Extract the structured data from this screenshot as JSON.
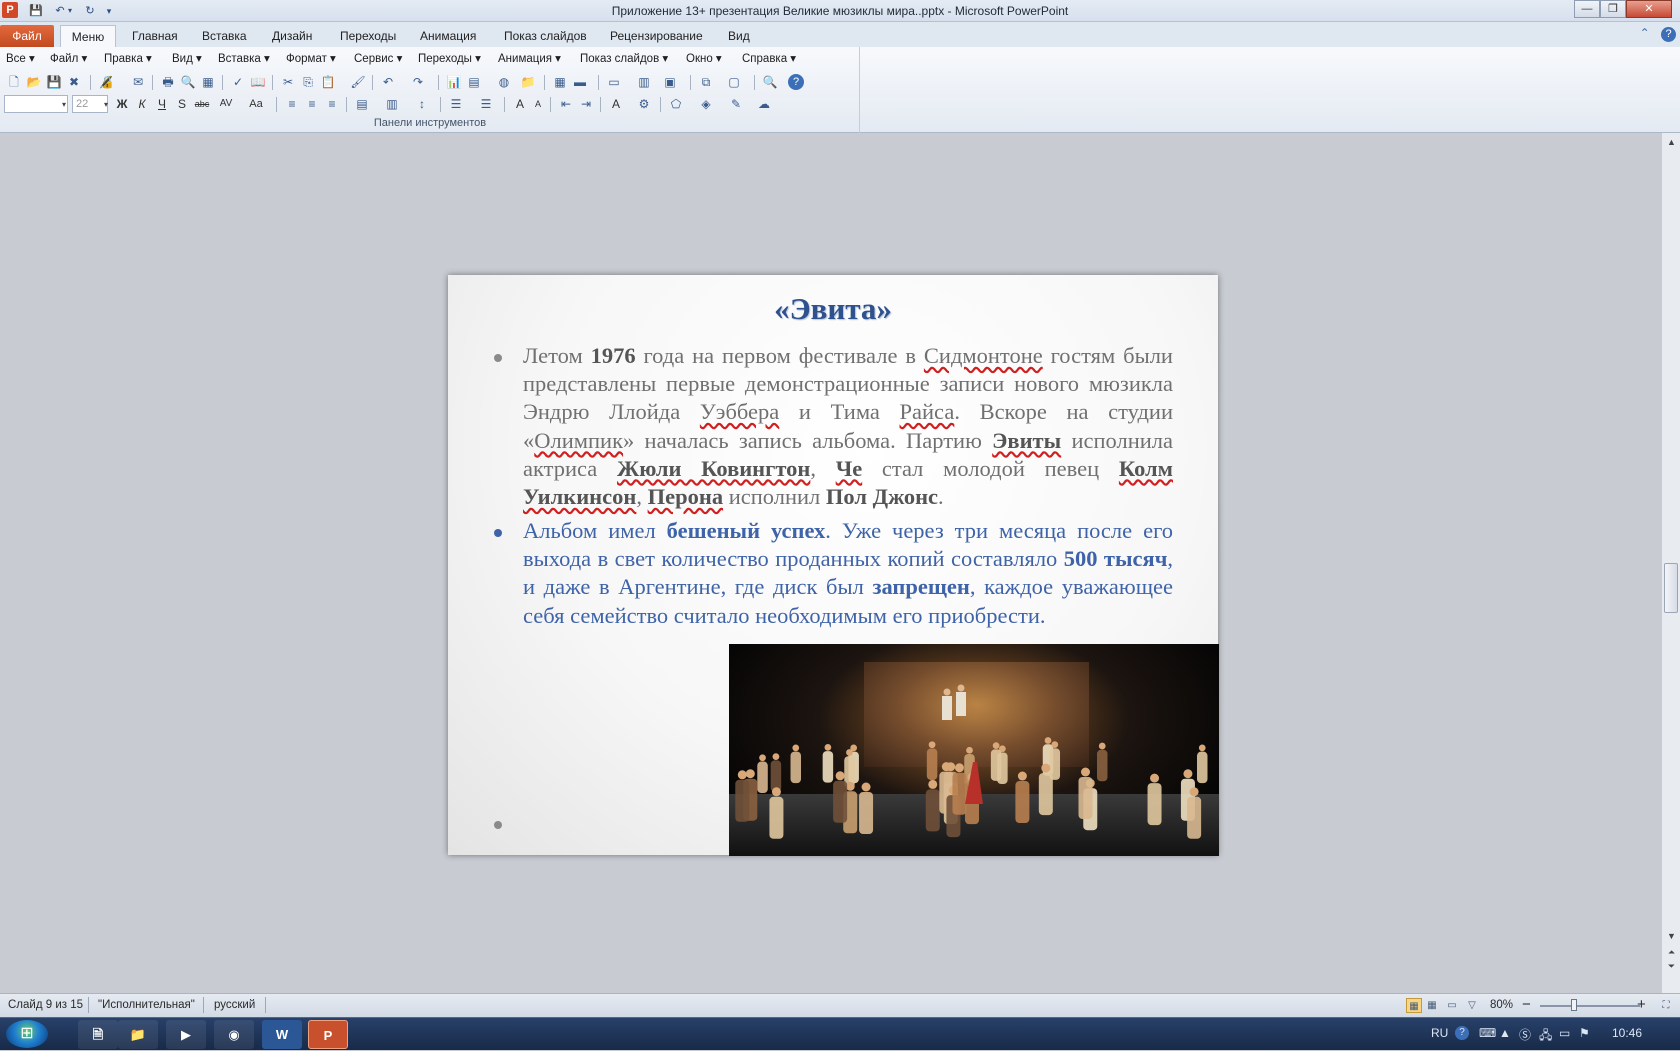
{
  "window": {
    "title": "Приложение 13+ презентация Великие мюзиклы мира..pptx - Microsoft PowerPoint",
    "app_icon_letter": "P",
    "minimize": "—",
    "restore": "❐",
    "close": "✕"
  },
  "tabs": [
    {
      "label": "Файл"
    },
    {
      "label": "Меню"
    },
    {
      "label": "Главная"
    },
    {
      "label": "Вставка"
    },
    {
      "label": "Дизайн"
    },
    {
      "label": "Переходы"
    },
    {
      "label": "Анимация"
    },
    {
      "label": "Показ слайдов"
    },
    {
      "label": "Рецензирование"
    },
    {
      "label": "Вид"
    }
  ],
  "active_tab": "Меню",
  "classic_menu": [
    {
      "label": "Все ▾"
    },
    {
      "label": "Файл ▾"
    },
    {
      "label": "Правка ▾"
    },
    {
      "label": "Вид ▾"
    },
    {
      "label": "Вставка ▾"
    },
    {
      "label": "Формат ▾"
    },
    {
      "label": "Сервис ▾"
    },
    {
      "label": "Переходы ▾"
    },
    {
      "label": "Анимация ▾"
    },
    {
      "label": "Показ слайдов ▾"
    },
    {
      "label": "Окно ▾"
    },
    {
      "label": "Справка ▾"
    }
  ],
  "toolbar": {
    "font_size_placeholder": "22",
    "group_label": "Панели инструментов",
    "row2_text": [
      "Ж",
      "К",
      "Ч",
      "S",
      "abc",
      "AV",
      "Aa"
    ]
  },
  "slide": {
    "title": "«Эвита»",
    "p1": {
      "t1": "Летом ",
      "b1": "1976",
      "t2": " года на первом фестивале в ",
      "u1": "Сидмонтоне",
      "t3": " гостям были представлены первые демонстрационные записи нового мюзикла Эндрю Ллойда ",
      "u2": "Уэббера",
      "t4": " и Тима ",
      "u3": "Райса",
      "t5": ". Вскоре на студии «",
      "u4": "Олимпик",
      "t6": "» началась запись альбома. Партию ",
      "b2": "Эвиты",
      "t7": " исполнила актриса ",
      "b3": "Жюли Ковингтон",
      "t8": ", ",
      "b4": "Че",
      "t9": " стал молодой певец ",
      "b5": "Колм Уилкинсон",
      "t10": ", ",
      "b6": "Перона",
      "t11": " исполнил ",
      "b7": "Пол Джонс",
      "t12": "."
    },
    "p2": {
      "t1": "Альбом имел ",
      "b1": "бешеный успех",
      "t2": ". Уже через три месяца после его выхода в свет количество проданных копий составляло ",
      "b2": "500 тысяч",
      "t3": ", и даже в Аргентине, где диск был ",
      "b3": "запрещен",
      "t4": ", каждое уважающее себя семейство считало необходимым его приобрести."
    },
    "colors": {
      "title": "#2f528f",
      "p1": "#707070",
      "p2": "#3e63a8"
    }
  },
  "status": {
    "slide": "Слайд 9 из 15",
    "theme": "\"Исполнительная\"",
    "lang": "русский",
    "zoom": "80%",
    "zoom_minus": "−",
    "zoom_plus": "+"
  },
  "taskbar": {
    "lang": "RU",
    "time": "10:46",
    "apps": [
      "file-icon",
      "explorer-icon",
      "media-player-icon",
      "chrome-icon",
      "word-icon",
      "powerpoint-icon"
    ]
  }
}
